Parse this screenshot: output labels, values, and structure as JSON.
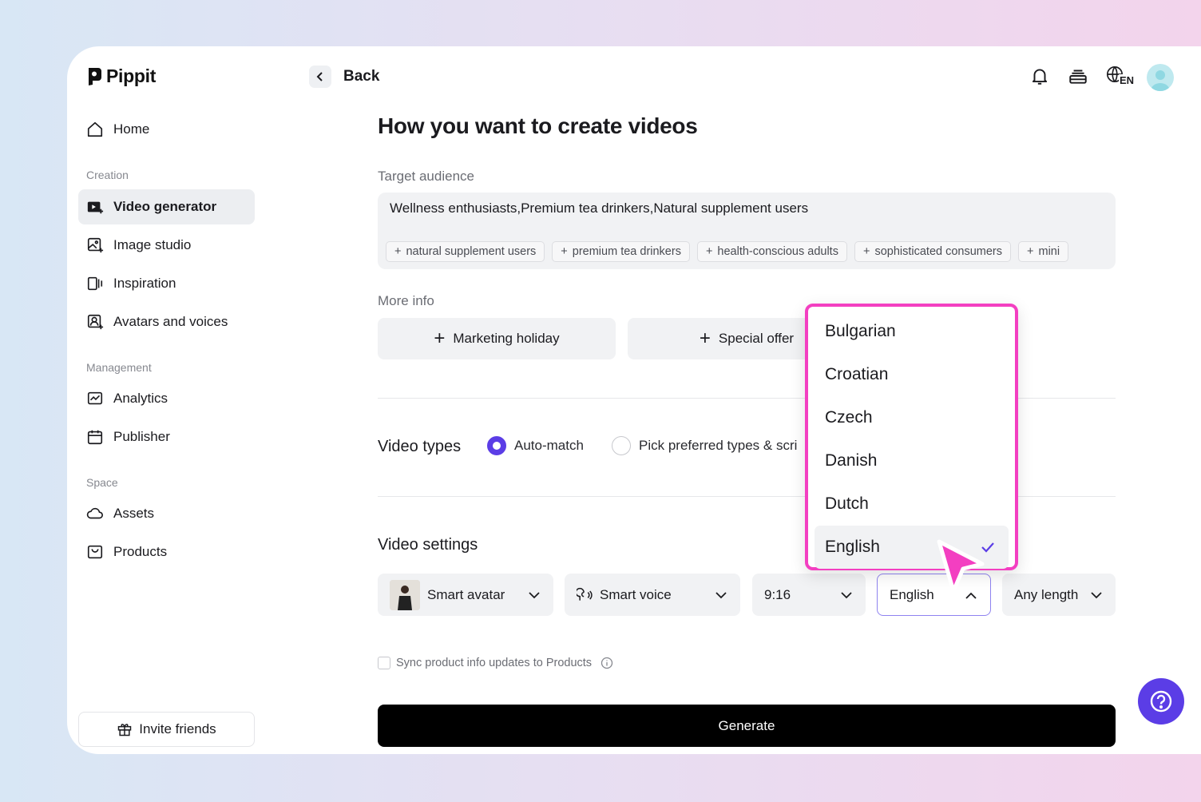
{
  "app": {
    "name": "Pippit"
  },
  "sidebar": {
    "home": "Home",
    "sections": {
      "creation": "Creation",
      "management": "Management",
      "space": "Space"
    },
    "items": {
      "video_generator": "Video generator",
      "image_studio": "Image studio",
      "inspiration": "Inspiration",
      "avatars_voices": "Avatars and voices",
      "analytics": "Analytics",
      "publisher": "Publisher",
      "assets": "Assets",
      "products": "Products"
    },
    "invite": "Invite friends"
  },
  "topbar": {
    "back": "Back",
    "language_badge": "EN"
  },
  "main": {
    "title": "How you want to create videos",
    "target_audience": {
      "label": "Target audience",
      "value": "Wellness enthusiasts,Premium tea drinkers,Natural supplement users",
      "suggestions": [
        "natural supplement users",
        "premium tea drinkers",
        "health-conscious adults",
        "sophisticated consumers",
        "mini"
      ]
    },
    "more_info": {
      "label": "More info",
      "buttons": [
        "Marketing holiday",
        "Special offer"
      ]
    },
    "video_types": {
      "label": "Video types",
      "options": [
        "Auto-match",
        "Pick preferred types & scri"
      ],
      "selected": "Auto-match"
    },
    "video_settings": {
      "label": "Video settings",
      "avatar": "Smart avatar",
      "voice": "Smart voice",
      "ratio": "9:16",
      "language": "English",
      "length": "Any length"
    },
    "sync_label": "Sync product info updates to Products",
    "generate": "Generate"
  },
  "language_dropdown": {
    "options": [
      "Bulgarian",
      "Croatian",
      "Czech",
      "Danish",
      "Dutch",
      "English"
    ],
    "selected": "English"
  },
  "colors": {
    "accent": "#5b3de6",
    "highlight": "#f33fc1"
  }
}
